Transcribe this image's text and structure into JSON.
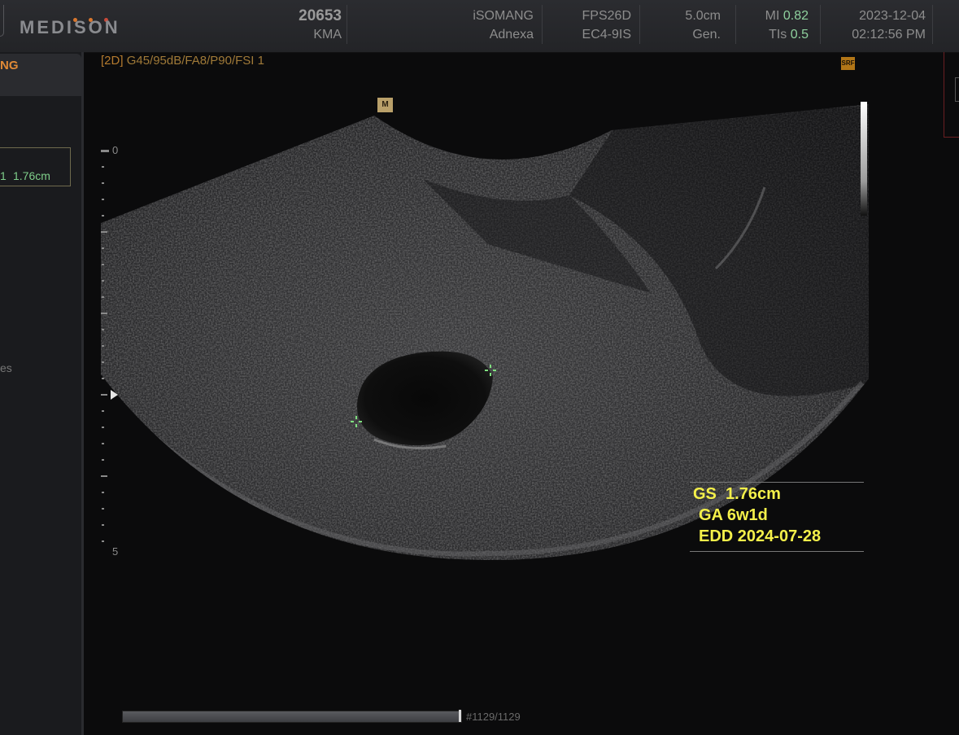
{
  "header": {
    "logo": "MEDISON",
    "logo_dot_colors": [
      "#d9772e",
      "#d9772e",
      "#c94a3a"
    ],
    "study_id": "20653",
    "institution": "KMA",
    "operator": "iSOMANG",
    "application": "Adnexa",
    "preset": "FPS26D",
    "probe": "EC4-9IS",
    "depth": "5.0cm",
    "frequency_mode": "Gen.",
    "mi_label": "MI",
    "mi_value": "0.82",
    "tis_label": "TIs",
    "tis_value": "0.5",
    "date": "2023-12-04",
    "time": "02:12:56 PM"
  },
  "left_panel": {
    "tab_label": "NG",
    "measurement_value": "1.76cm",
    "measurement_prefix": "1",
    "truncated_text": "es"
  },
  "image": {
    "mode": "[2D]",
    "params": "G45/95dB/FA8/P90/FSI 1",
    "sri_badge": "SRF",
    "orientation_mark": "M",
    "depth_top": "0",
    "depth_bottom": "5"
  },
  "measurement": {
    "gs_label": "GS",
    "gs_value": "1.76cm",
    "ga_label": "GA",
    "ga_value": "6w1d",
    "edd_label": "EDD",
    "edd_value": "2024-07-28"
  },
  "cine": {
    "counter": "#1129/1129",
    "position_fraction": 1.0
  },
  "colors": {
    "measurement_text": "#f4f04a",
    "caliper": "#7fe07f",
    "mi_value": "#8fd19e",
    "params_text": "#b47a2e"
  }
}
